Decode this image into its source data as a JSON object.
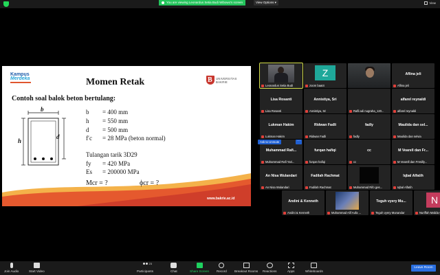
{
  "top": {
    "sharing_notice": "You are viewing Leonardus Setia Budi Wibowo's screen",
    "view_options": "View Options ▾",
    "view_button": "View"
  },
  "slide": {
    "logo_left_line1": "Kampus",
    "logo_left_line2": "Merdeka",
    "title": "Momen Retak",
    "logo_right_line1": "UNIVERSITAS",
    "logo_right_line2": "BAKRIE",
    "subtitle": "Contoh soal balok beton bertulang:",
    "diagram": {
      "b_label": "b",
      "h_label": "h",
      "d_label": "d"
    },
    "given": [
      {
        "sym": "b",
        "val": "= 400 mm"
      },
      {
        "sym": "h",
        "val": "= 550 mm"
      },
      {
        "sym": "d",
        "val": "= 500 mm"
      },
      {
        "sym": "f′c",
        "val": "= 28 MPa (beton normal)"
      }
    ],
    "rebar_title": "Tulangan tarik 3D29",
    "rebar": [
      {
        "sym": "fy",
        "val": "= 420 MPa"
      },
      {
        "sym": "Es",
        "val": "= 200000 MPa"
      }
    ],
    "question_mcr": "Mcr = ?",
    "question_phi": "ϕcr = ?",
    "url": "www.bakrie.ac.id"
  },
  "participants": [
    {
      "name": "",
      "label": "Leonardus Setia Budi",
      "type": "video-leo",
      "active": true
    },
    {
      "name": "Z",
      "label": "zoom baat4",
      "type": "avatar-z"
    },
    {
      "name": "",
      "label": "",
      "type": "video-zoom"
    },
    {
      "name": "Aflina jeli",
      "label": "Aflina jeli"
    },
    {
      "name": "Lisa Rosanti",
      "label": "Lisa Rosanti"
    },
    {
      "name": "Annistiya, Sri",
      "label": "Annistiya, Sri"
    },
    {
      "name": "",
      "label": "Rafli adi nugraha_120...",
      "type": "blank"
    },
    {
      "name": "alfarel reynaldi",
      "label": "alfarel reynaldi"
    },
    {
      "name": "Lukman Hakim",
      "label": "Lukman Hakim"
    },
    {
      "name": "Ridwan Fadli",
      "label": "Ridwan Fadli"
    },
    {
      "name": "fadly",
      "label": "fadly"
    },
    {
      "name": "Maulida dan sel...",
      "label": "Maulida dan selvia"
    },
    {
      "name": "Muhammad Rafi...",
      "label": "Muhammad Rafi Yari..."
    },
    {
      "name": "furqan hafiqi",
      "label": "furqan hafiqi"
    },
    {
      "name": "cc",
      "label": "cc"
    },
    {
      "name": "M Vearell dan Fr...",
      "label": "M Vearell dan Fresilly..."
    },
    {
      "name": "An Nisa Wulandari",
      "label": "An Nisa Wulandari"
    },
    {
      "name": "Fadilah Rachmat",
      "label": "Fadilah Rachmat"
    },
    {
      "name": "",
      "label": "Muhammad Rifo ges...",
      "type": "video-dark"
    },
    {
      "name": "Iqbal Alfatih",
      "label": "Iqbal Alfatih"
    },
    {
      "name": "Andini & Kenneth",
      "label": "Andini & Kenneth"
    },
    {
      "name": "",
      "label": "Muhammad Alif Aufa ...",
      "type": "video-pic"
    },
    {
      "name": "Teguh vyery Mu...",
      "label": "Teguh vyery Munandar"
    },
    {
      "name": "N",
      "label": "Nuriffah Malida Chania",
      "type": "avatar-n"
    }
  ],
  "ask_unmute": "Ask to Unmute",
  "ask_more": "···",
  "toolbar": {
    "join_audio": "Join Audio",
    "start_video": "Start Video",
    "participants": "Participants",
    "participants_count": "23",
    "chat": "Chat",
    "share_screen": "Share Screen",
    "record": "Record",
    "breakout": "Breakout Rooms",
    "reactions": "Reactions",
    "apps": "Apps",
    "whiteboards": "Whiteboards",
    "leave": "Leave Room"
  },
  "colors": {
    "accent_green": "#1ed15f",
    "leave_blue": "#2a6fe0",
    "active_outline": "#d6e04a",
    "slide_wave_orange": "#e5592e"
  }
}
